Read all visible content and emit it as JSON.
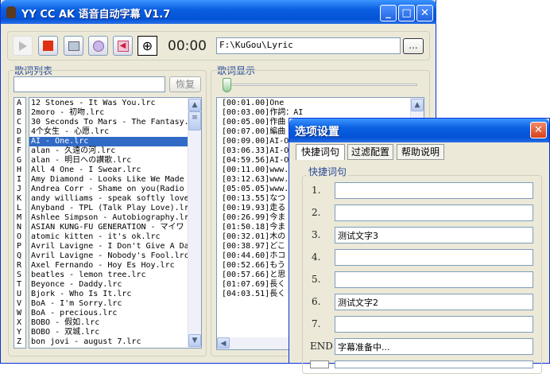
{
  "main_window": {
    "title": "YY CC AK 语音自动字幕 V1.7",
    "minimize": "_",
    "maximize": "□",
    "close": "✕",
    "toolbar": {
      "time": "00:00",
      "path": "F:\\KuGou\\Lyric",
      "browse_label": "...",
      "icons": [
        "play-icon",
        "stop-icon",
        "open-icon",
        "settings-icon",
        "export-icon",
        "target-icon"
      ]
    },
    "song_list": {
      "group_label": "歌词列表",
      "search_value": "",
      "restore_label": "恢复",
      "letters": [
        "A",
        "B",
        "C",
        "D",
        "E",
        "F",
        "G",
        "H",
        "I",
        "J",
        "K",
        "L",
        "M",
        "N",
        "O",
        "P",
        "Q",
        "R",
        "S",
        "T",
        "U",
        "V",
        "W",
        "X",
        "Y",
        "Z"
      ],
      "selected_index": 4,
      "items": [
        "12 Stones - It Was You.lrc",
        "2moro - 初吻.lrc",
        "30 Seconds To Mars - The Fantasy.",
        "4个女生 - 心愿.lrc",
        "AI - One.lrc",
        "alan - 久遠の河.lrc",
        "alan - 明日への讃歌.lrc",
        "All 4 One - I Swear.lrc",
        "Amy Diamond - Looks Like We Made",
        "Andrea Corr - Shame on you(Radio",
        "andy williams - speak softly love",
        "Anyband - TPL (Talk Play Love).lr",
        "Ashlee Simpson - Autobiography.lr",
        "ASIAN KUNG-FU GENERATION - マイワ",
        "atomic kitten - it's ok.lrc",
        "Avril Lavigne - I Don't Give A Da",
        "Avril Lavigne - Nobody's Fool.lrc",
        "Axel Fernando - Hoy Es Hoy.lrc",
        "beatles - lemon tree.lrc",
        "Beyonce - Daddy.lrc",
        "Bjork - Who Is It.lrc",
        "BoA - I'm Sorry.lrc",
        "BoA - precious.lrc",
        "BOBO - 假如.lrc",
        "BOBO - 双城.lrc",
        "bon jovi - august 7.lrc"
      ]
    },
    "lyrics": {
      "group_label": "歌词显示",
      "lines": [
        "[00:01.00]One",
        "[00:03.00]作詞：AI",
        "[00:05.00]作曲",
        "[00:07.00]編曲",
        "[00:09.00]AI-O",
        "[03:06.33]AI-O",
        "[04:59.56]AI-O",
        "[00:11.00]www.",
        "[03:12.63]www.",
        "[05:05.05]www.",
        "[00:13.55]なつ",
        "[00:19.93]走る",
        "[00:26.99]今ま",
        "[01:50.18]今ま",
        "[00:32.01]木の",
        "[00:38.97]どこ",
        "[00:44.60]ホコ",
        "[00:52.66]もう",
        "[00:57.66]と思",
        "[01:07.69]長く",
        "[04:03.51]長く"
      ]
    }
  },
  "dialog": {
    "title": "选项设置",
    "close": "✕",
    "tabs": [
      "快捷词句",
      "过滤配置",
      "帮助说明"
    ],
    "active_tab": 0,
    "group_label": "快捷词句",
    "phrases": [
      {
        "label": "1.",
        "value": ""
      },
      {
        "label": "2.",
        "value": ""
      },
      {
        "label": "3.",
        "value": "测试文字3"
      },
      {
        "label": "4.",
        "value": ""
      },
      {
        "label": "5.",
        "value": ""
      },
      {
        "label": "6.",
        "value": "测试文字2"
      },
      {
        "label": "7.",
        "value": ""
      },
      {
        "label": "END",
        "value": "字幕准备中..."
      }
    ]
  }
}
